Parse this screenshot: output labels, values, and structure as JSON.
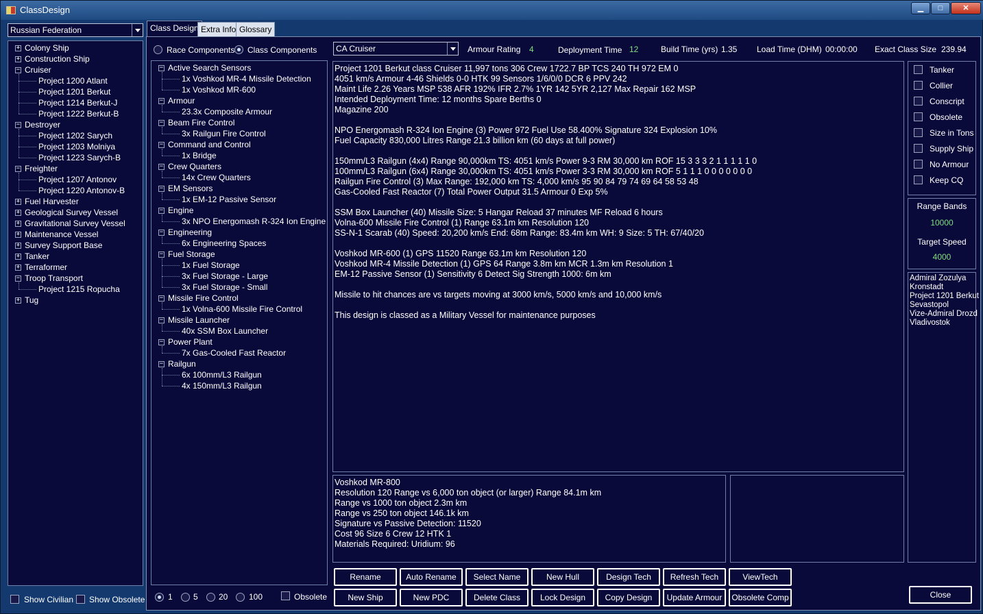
{
  "window": {
    "title": "ClassDesign",
    "minimize": "▁",
    "maximize": "□",
    "close": "✕"
  },
  "race_select": "Russian Federation",
  "tabs": [
    "Class Design",
    "Extra Info",
    "Glossary"
  ],
  "class_tree": [
    {
      "label": "Colony Ship",
      "level": 0,
      "expander": "+"
    },
    {
      "label": "Construction Ship",
      "level": 0,
      "expander": "+"
    },
    {
      "label": "Cruiser",
      "level": 0,
      "expander": "−"
    },
    {
      "label": "Project 1200 Atlant",
      "level": 1
    },
    {
      "label": "Project 1201 Berkut",
      "level": 1
    },
    {
      "label": "Project 1214 Berkut-J",
      "level": 1
    },
    {
      "label": "Project 1222 Berkut-B",
      "level": 1
    },
    {
      "label": "Destroyer",
      "level": 0,
      "expander": "−"
    },
    {
      "label": "Project 1202 Sarych",
      "level": 1
    },
    {
      "label": "Project 1203 Molniya",
      "level": 1
    },
    {
      "label": "Project 1223 Sarych-B",
      "level": 1
    },
    {
      "label": "Freighter",
      "level": 0,
      "expander": "−"
    },
    {
      "label": "Project 1207 Antonov",
      "level": 1
    },
    {
      "label": "Project 1220 Antonov-B",
      "level": 1
    },
    {
      "label": "Fuel Harvester",
      "level": 0,
      "expander": "+"
    },
    {
      "label": "Geological Survey Vessel",
      "level": 0,
      "expander": "+"
    },
    {
      "label": "Gravitational Survey Vessel",
      "level": 0,
      "expander": "+"
    },
    {
      "label": "Maintenance Vessel",
      "level": 0,
      "expander": "+"
    },
    {
      "label": "Survey Support Base",
      "level": 0,
      "expander": "+"
    },
    {
      "label": "Tanker",
      "level": 0,
      "expander": "+"
    },
    {
      "label": "Terraformer",
      "level": 0,
      "expander": "+"
    },
    {
      "label": "Troop Transport",
      "level": 0,
      "expander": "−"
    },
    {
      "label": "Project 1215 Ropucha",
      "level": 1
    },
    {
      "label": "Tug",
      "level": 0,
      "expander": "+"
    }
  ],
  "show_civilian": "Show Civilian",
  "show_obsolete": "Show Obsolete",
  "component_mode": {
    "race": "Race Components",
    "class": "Class Components"
  },
  "component_tree": [
    {
      "label": "Active Search Sensors",
      "level": 0,
      "expander": "−"
    },
    {
      "label": "1x Voshkod MR-4 Missile Detection",
      "level": 1
    },
    {
      "label": "1x Voshkod MR-600",
      "level": 1
    },
    {
      "label": "Armour",
      "level": 0,
      "expander": "−"
    },
    {
      "label": "23.3x Composite Armour",
      "level": 1
    },
    {
      "label": "Beam Fire Control",
      "level": 0,
      "expander": "−"
    },
    {
      "label": "3x Railgun Fire Control",
      "level": 1
    },
    {
      "label": "Command and Control",
      "level": 0,
      "expander": "−"
    },
    {
      "label": "1x Bridge",
      "level": 1
    },
    {
      "label": "Crew Quarters",
      "level": 0,
      "expander": "−"
    },
    {
      "label": "14x Crew Quarters",
      "level": 1
    },
    {
      "label": "EM Sensors",
      "level": 0,
      "expander": "−"
    },
    {
      "label": "1x EM-12 Passive Sensor",
      "level": 1
    },
    {
      "label": "Engine",
      "level": 0,
      "expander": "−"
    },
    {
      "label": "3x NPO Energomash R-324 Ion Engine",
      "level": 1
    },
    {
      "label": "Engineering",
      "level": 0,
      "expander": "−"
    },
    {
      "label": "6x Engineering Spaces",
      "level": 1
    },
    {
      "label": "Fuel Storage",
      "level": 0,
      "expander": "−"
    },
    {
      "label": "1x Fuel Storage",
      "level": 1
    },
    {
      "label": "3x Fuel Storage - Large",
      "level": 1
    },
    {
      "label": "3x Fuel Storage - Small",
      "level": 1
    },
    {
      "label": "Missile Fire Control",
      "level": 0,
      "expander": "−"
    },
    {
      "label": "1x Volna-600 Missile Fire Control",
      "level": 1
    },
    {
      "label": "Missile Launcher",
      "level": 0,
      "expander": "−"
    },
    {
      "label": "40x SSM Box Launcher",
      "level": 1
    },
    {
      "label": "Power Plant",
      "level": 0,
      "expander": "−"
    },
    {
      "label": "7x Gas-Cooled Fast Reactor",
      "level": 1
    },
    {
      "label": "Railgun",
      "level": 0,
      "expander": "−"
    },
    {
      "label": "6x 100mm/L3 Railgun",
      "level": 1
    },
    {
      "label": "4x 150mm/L3 Railgun",
      "level": 1
    }
  ],
  "quantity_options": [
    "1",
    "5",
    "20",
    "100"
  ],
  "obsolete_label": "Obsolete",
  "class_select": "CA Cruiser",
  "stats": {
    "armour_label": "Armour Rating",
    "armour_value": "4",
    "deploy_label": "Deployment Time",
    "deploy_value": "12",
    "build_label": "Build Time (yrs)",
    "build_value": "1.35",
    "load_label": "Load Time (DHM)",
    "load_value": "00:00:00",
    "size_label": "Exact Class Size",
    "size_value": "239.94"
  },
  "summary_lines": [
    "Project 1201 Berkut class Cruiser      11,997 tons       306 Crew       1722.7 BP       TCS 240     TH 972     EM 0",
    "4051 km/s      Armour 4-46       Shields 0-0       HTK 99      Sensors 1/6/0/0      DCR 6      PPV 242",
    "Maint Life 2.26 Years     MSP 538     AFR 192%     IFR 2.7%     1YR 142     5YR 2,127     Max Repair 162 MSP",
    "Intended Deployment Time: 12 months    Spare Berths 0",
    "Magazine 200",
    "",
    "NPO Energomash R-324 Ion Engine (3)     Power 972     Fuel Use 58.400%     Signature 324     Explosion 10%",
    "Fuel Capacity 830,000 Litres     Range 21.3 billion km   (60 days at full power)",
    "",
    "150mm/L3 Railgun (4x4)     Range 90,000km     TS: 4051 km/s     Power 9-3     RM 30,000 km    ROF 15        3 3 3 2 1 1 1 1 1 0",
    "100mm/L3 Railgun (6x4)     Range 30,000km     TS: 4051 km/s     Power 3-3     RM 30,000 km    ROF 5        1 1 1 0 0 0 0 0 0 0",
    "Railgun Fire Control (3)     Max Range: 192,000 km    TS: 4,000 km/s       95 90 84 79 74 69 64 58 53 48",
    "Gas-Cooled Fast Reactor (7)     Total Power Output 31.5    Armour 0    Exp 5%",
    "",
    "SSM Box Launcher (40)     Missile Size: 5     Hangar Reload 37 minutes     MF Reload 6 hours",
    "Volna-600 Missile Fire Control (1)       Range 63.1m km      Resolution 120",
    "SS-N-1 Scarab (40)  Speed: 20,200 km/s    End: 68m    Range: 83.4m km    WH: 9    Size: 5     TH: 67/40/20",
    "",
    "Voshkod MR-600 (1)      GPS 11520       Range 63.1m km      Resolution 120",
    "Voshkod MR-4 Missile Detection (1)       GPS 64       Range 3.8m km      MCR 1.3m km      Resolution 1",
    "EM-12 Passive Sensor (1)       Sensitivity 6       Detect Sig Strength 1000:  6m km",
    "",
    "Missile to hit chances are vs targets moving at 3000 km/s, 5000 km/s and 10,000 km/s",
    "",
    "This design is classed as a Military Vessel for maintenance purposes"
  ],
  "component_detail_lines": [
    "Voshkod MR-800",
    "Resolution 120    Range vs 6,000 ton object (or larger) Range 84.1m km",
    "Range vs 1000 ton object 2.3m km",
    "Range vs 250 ton object 146.1k km",
    "Signature vs Passive Detection: 11520",
    "Cost 96    Size 6    Crew 12    HTK 1",
    "Materials Required: Uridium: 96"
  ],
  "flags": [
    "Tanker",
    "Collier",
    "Conscript",
    "Obsolete",
    "Size in Tons",
    "Supply Ship",
    "No Armour",
    "Keep CQ"
  ],
  "range_bands": {
    "label": "Range Bands",
    "value": "10000"
  },
  "target_speed": {
    "label": "Target Speed",
    "value": "4000"
  },
  "names_list": [
    "Admiral Zozulya",
    "Kronstadt",
    "Project 1201 Berkut",
    "Sevastopol",
    "Vize-Admiral Drozd",
    "Vladivostok"
  ],
  "buttons_row1": [
    "Rename",
    "Auto Rename",
    "Select Name",
    "New Hull",
    "Design Tech",
    "Refresh Tech",
    "ViewTech"
  ],
  "buttons_row2": [
    "New Ship",
    "New PDC",
    "Delete Class",
    "Lock Design",
    "Copy Design",
    "Update Armour",
    "Obsolete Comp"
  ],
  "close_button": "Close"
}
